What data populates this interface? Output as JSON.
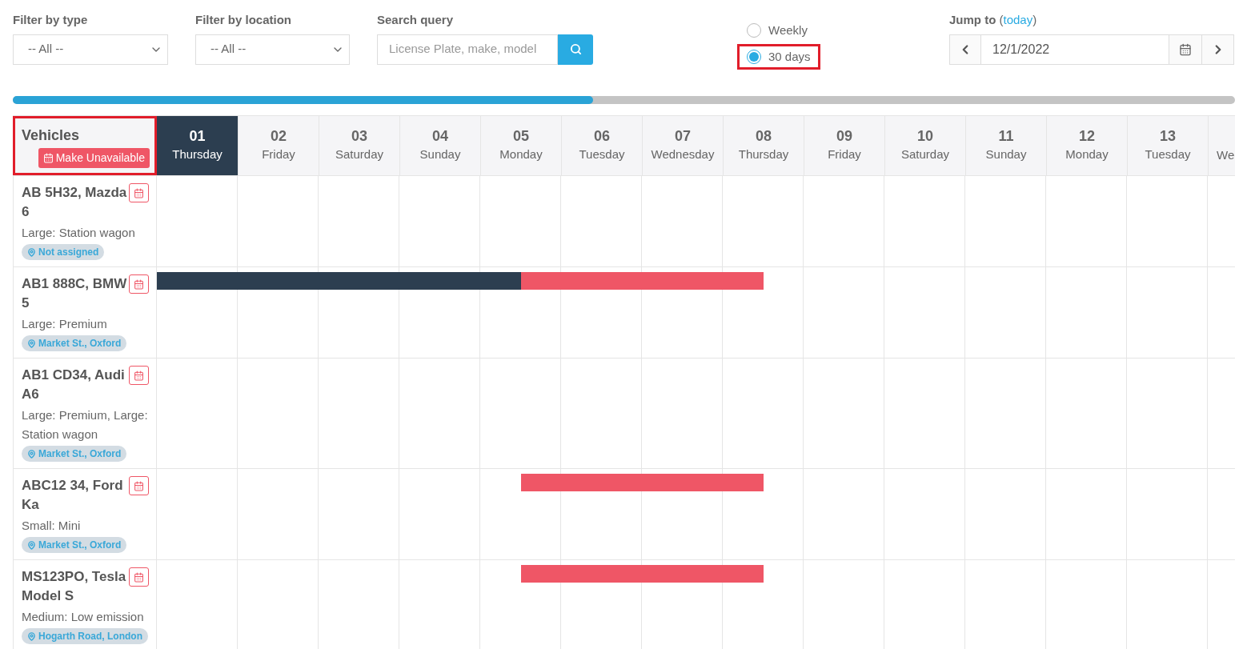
{
  "filters": [
    {
      "label": "Filter by type",
      "value": "-- All --"
    },
    {
      "label": "Filter by location",
      "value": "-- All --"
    }
  ],
  "search": {
    "label": "Search query",
    "placeholder": "License Plate, make, model"
  },
  "view_options": [
    {
      "label": "Weekly",
      "selected": false,
      "highlighted": false
    },
    {
      "label": "30 days",
      "selected": true,
      "highlighted": true
    }
  ],
  "jump_to": {
    "label": "Jump to",
    "link_open": "(",
    "link": "today",
    "link_close": ")",
    "date": "12/1/2022"
  },
  "vehicles_header": {
    "title": "Vehicles",
    "button": "Make Unavailable",
    "highlighted": true
  },
  "days": [
    {
      "number": "01",
      "name": "Thursday",
      "selected": true,
      "cut": false
    },
    {
      "number": "02",
      "name": "Friday",
      "selected": false,
      "cut": false
    },
    {
      "number": "03",
      "name": "Saturday",
      "selected": false,
      "cut": false
    },
    {
      "number": "04",
      "name": "Sunday",
      "selected": false,
      "cut": false
    },
    {
      "number": "05",
      "name": "Monday",
      "selected": false,
      "cut": false
    },
    {
      "number": "06",
      "name": "Tuesday",
      "selected": false,
      "cut": false
    },
    {
      "number": "07",
      "name": "Wednesday",
      "selected": false,
      "cut": false
    },
    {
      "number": "08",
      "name": "Thursday",
      "selected": false,
      "cut": false
    },
    {
      "number": "09",
      "name": "Friday",
      "selected": false,
      "cut": false
    },
    {
      "number": "10",
      "name": "Saturday",
      "selected": false,
      "cut": false
    },
    {
      "number": "11",
      "name": "Sunday",
      "selected": false,
      "cut": false
    },
    {
      "number": "12",
      "name": "Monday",
      "selected": false,
      "cut": false
    },
    {
      "number": "13",
      "name": "Tuesday",
      "selected": false,
      "cut": false
    },
    {
      "name": "We",
      "selected": false,
      "cut": true
    }
  ],
  "vehicles": [
    {
      "name": "AB 5H32, Mazda 6",
      "type": "Large: Station wagon",
      "location": "Not assigned"
    },
    {
      "name": "AB1 888C, BMW 5",
      "type": "Large: Premium",
      "location": "Market St., Oxford",
      "half_day_slots": [
        {
          "kind": "booking"
        },
        {
          "kind": "booking"
        },
        {
          "kind": "booking"
        },
        {
          "kind": "booking"
        },
        {
          "kind": "booking"
        },
        {
          "kind": "booking"
        },
        {
          "kind": "booking"
        },
        {
          "kind": "booking"
        },
        {
          "kind": "booking"
        },
        {
          "kind": "unavailable"
        },
        {
          "kind": "unavailable"
        },
        {
          "kind": "unavailable"
        },
        {
          "kind": "unavailable"
        },
        {
          "kind": "unavailable"
        },
        {
          "kind": "unavailable"
        }
      ]
    },
    {
      "name": "AB1 CD34, Audi A6",
      "type": "Large: Premium, Large: Station wagon",
      "location": "Market St., Oxford"
    },
    {
      "name": "ABC12 34, Ford Ka",
      "type": "Small: Mini",
      "location": "Market St., Oxford",
      "half_day_slots": [
        {
          "kind": "free"
        },
        {
          "kind": "free"
        },
        {
          "kind": "free"
        },
        {
          "kind": "free"
        },
        {
          "kind": "free"
        },
        {
          "kind": "free"
        },
        {
          "kind": "free"
        },
        {
          "kind": "free"
        },
        {
          "kind": "free"
        },
        {
          "kind": "unavailable"
        },
        {
          "kind": "unavailable"
        },
        {
          "kind": "unavailable"
        },
        {
          "kind": "unavailable"
        },
        {
          "kind": "unavailable"
        },
        {
          "kind": "unavailable"
        }
      ]
    },
    {
      "name": "MS123PO, Tesla Model S",
      "type": "Medium: Low emission",
      "location": "Hogarth Road, London",
      "half_day_slots": [
        {
          "kind": "free"
        },
        {
          "kind": "free"
        },
        {
          "kind": "free"
        },
        {
          "kind": "free"
        },
        {
          "kind": "free"
        },
        {
          "kind": "free"
        },
        {
          "kind": "free"
        },
        {
          "kind": "free"
        },
        {
          "kind": "free"
        },
        {
          "kind": "unavailable"
        },
        {
          "kind": "unavailable"
        },
        {
          "kind": "unavailable"
        },
        {
          "kind": "unavailable"
        },
        {
          "kind": "unavailable"
        },
        {
          "kind": "unavailable"
        }
      ]
    }
  ]
}
